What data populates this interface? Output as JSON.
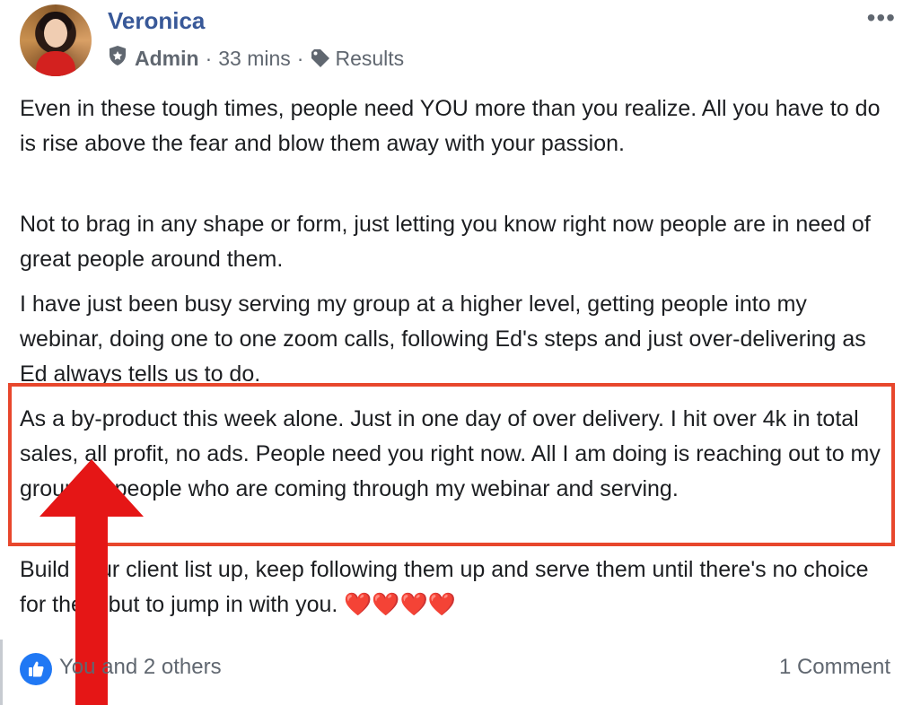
{
  "post": {
    "author": "Veronica",
    "role": "Admin",
    "time": "33 mins",
    "tag": "Results",
    "more_menu": "•••",
    "paragraphs": [
      "Even in these tough times, people need YOU more than you realize. All you have to do is rise above the fear and blow them away with your passion.",
      "Not to brag in any shape or form, just letting you know right now people are in need of great people around them.",
      "I have just been busy serving my group at a higher level, getting people into my webinar, doing one to one zoom calls, following Ed's steps and just over-delivering as Ed always tells us to do.",
      "As a by-product this week alone. Just in one day of over delivery. I hit over 4k in total sales, all profit, no ads. People need you right now. All I am doing is reaching out to my group, to people who are coming through my webinar and serving.",
      "Build your client list up, keep following them up and serve them until there's no choice for them but to jump in with you."
    ],
    "hearts": "❤️❤️❤️❤️"
  },
  "footer": {
    "reactions": "You and 2 others",
    "comments": "1 Comment"
  },
  "colors": {
    "author": "#385898",
    "highlight_border": "#e8472c",
    "arrow": "#e51616",
    "like": "#2078f4"
  },
  "icons": {
    "shield": "shield-icon",
    "tag": "tag-icon",
    "like": "thumbs-up-icon",
    "more": "more-dots-icon"
  }
}
